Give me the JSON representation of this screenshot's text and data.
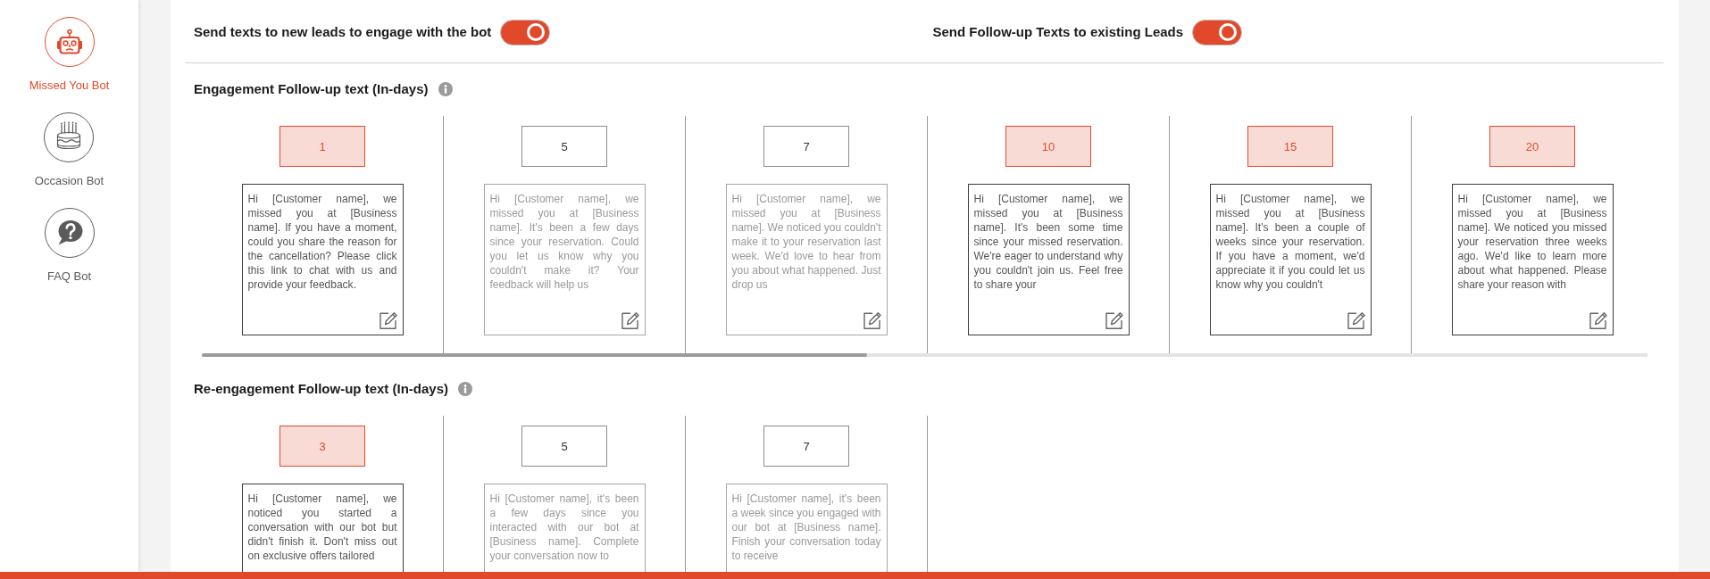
{
  "sidebar": {
    "items": [
      {
        "kind": "robot",
        "label": "Missed You Bot",
        "selected": true
      },
      {
        "kind": "cake",
        "label": "Occasion Bot",
        "selected": false
      },
      {
        "kind": "question",
        "label": "FAQ Bot",
        "selected": false
      }
    ]
  },
  "toggles": [
    {
      "label": "Send texts to new leads to engage with the bot",
      "on": true
    },
    {
      "label": "Send Follow-up Texts to existing Leads",
      "on": true
    }
  ],
  "sections": [
    {
      "title": "Engagement Follow-up text (In-days)",
      "steps": [
        {
          "day": "1",
          "selected": true,
          "message": "Hi [Customer name], we missed you at [Business name]. If you have a moment, could you share the reason for the cancellation? Please click this link to chat with us and provide your feedback."
        },
        {
          "day": "5",
          "selected": false,
          "message": "Hi [Customer name], we missed you at [Business name]. It's been a few days since your reservation. Could you let us know why you couldn't make it? Your feedback will help us"
        },
        {
          "day": "7",
          "selected": false,
          "message": "Hi [Customer name], we missed you at [Business name]. We noticed you couldn't make it to your reservation last week. We'd love to hear from you about what happened. Just drop us"
        },
        {
          "day": "10",
          "selected": true,
          "message": "Hi [Customer name], we missed you at [Business name]. It's been some time since your missed reservation. We're eager to understand why you couldn't join us. Feel free to share your"
        },
        {
          "day": "15",
          "selected": true,
          "message": "Hi [Customer name], we missed you at [Business name]. It's been a couple of weeks since your reservation. If you have a moment, we'd appreciate it if you could let us know why you couldn't"
        },
        {
          "day": "20",
          "selected": true,
          "message": "Hi [Customer name], we missed you at [Business name]. We noticed you missed your reservation three weeks ago. We'd like to learn more about what happened. Please share your reason with"
        }
      ]
    },
    {
      "title": "Re-engagement Follow-up text (In-days)",
      "steps": [
        {
          "day": "3",
          "selected": true,
          "message": "Hi [Customer name], we noticed you started a conversation with our bot but didn't finish it. Don't miss out on exclusive offers tailored"
        },
        {
          "day": "5",
          "selected": false,
          "message": "Hi [Customer name], it's been a few days since you interacted with our bot at [Business name]. Complete your conversation now to"
        },
        {
          "day": "7",
          "selected": false,
          "message": "Hi [Customer name], it's been a week since you engaged with our bot at [Business name]. Finish your conversation today to receive"
        }
      ]
    }
  ]
}
